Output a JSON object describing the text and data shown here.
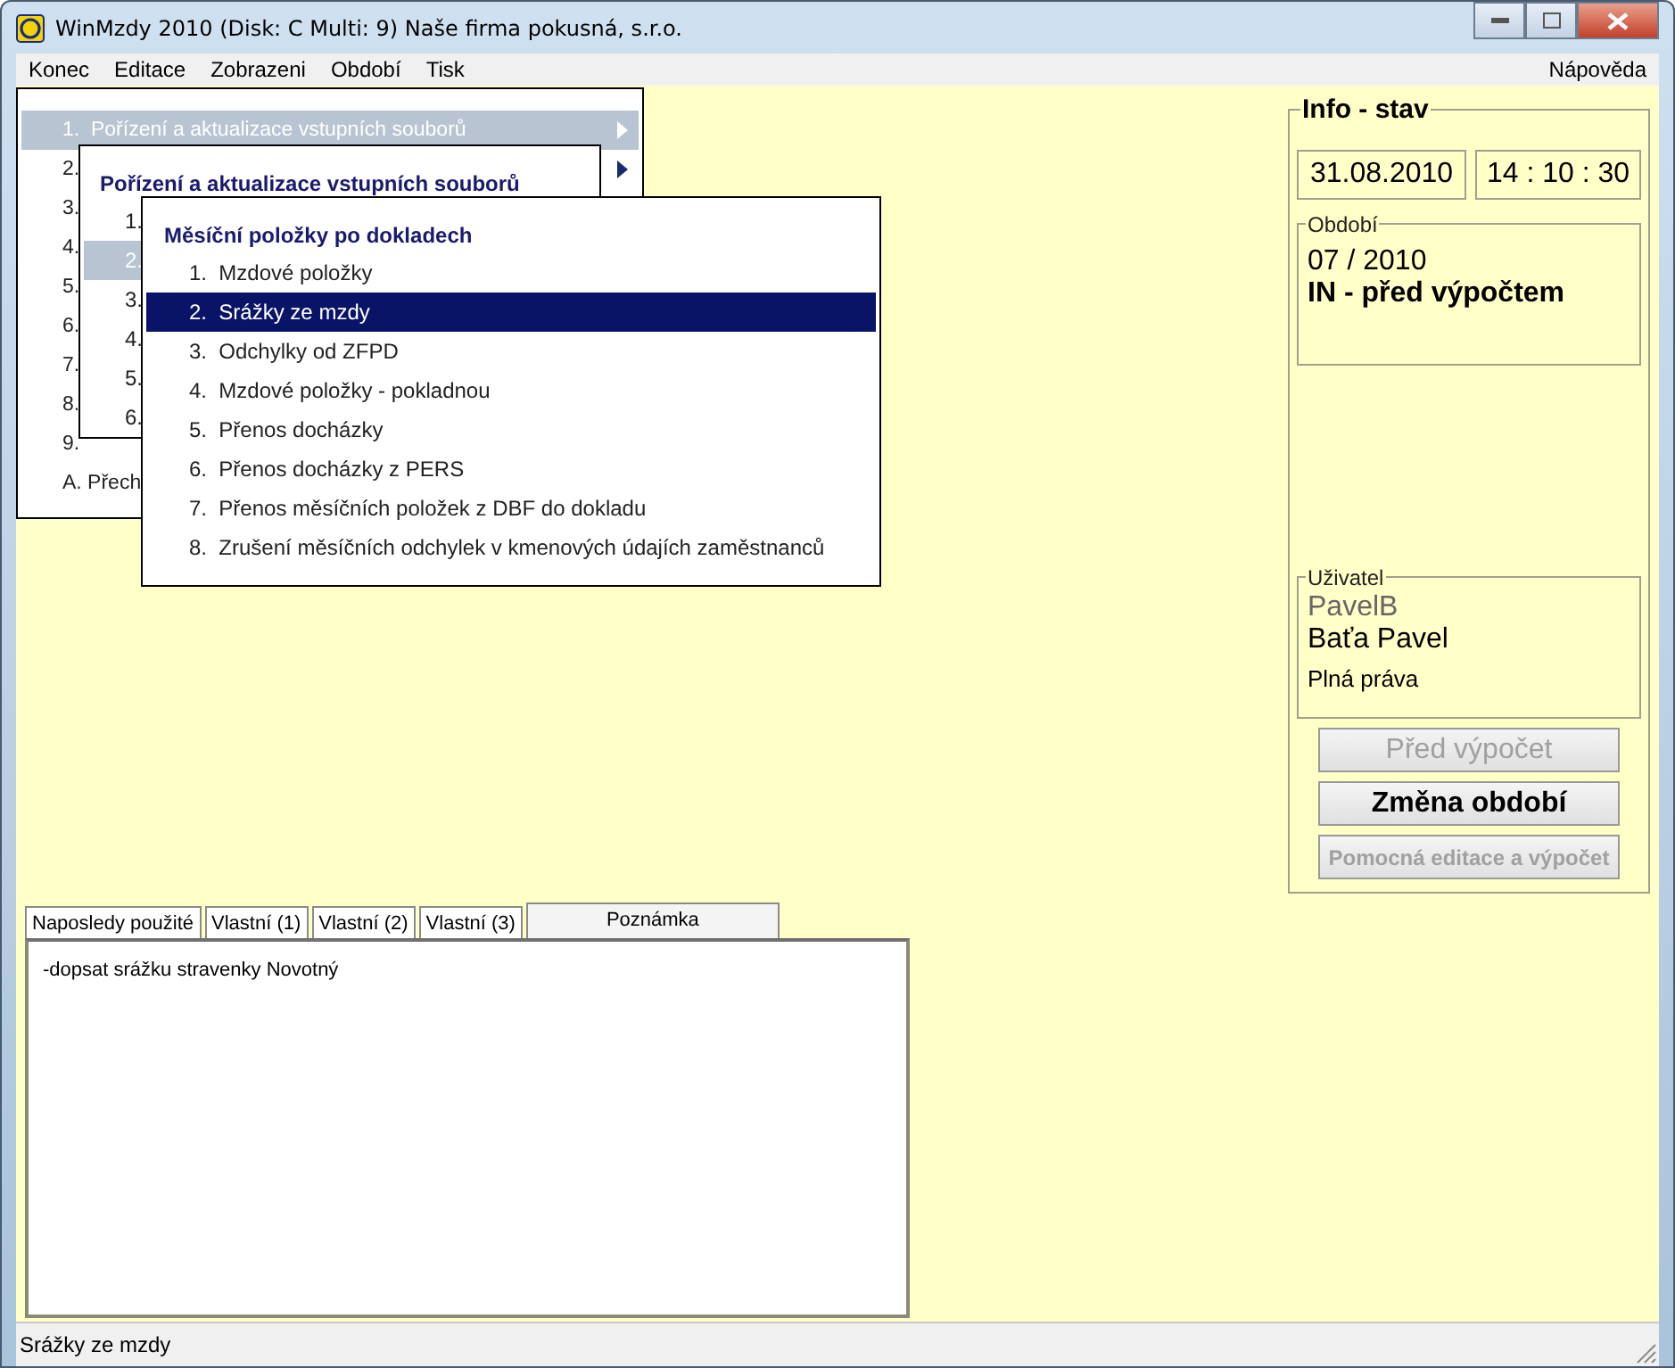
{
  "window": {
    "title": "WinMzdy 2010 (Disk: C Multi: 9) Naše firma pokusná, s.r.o."
  },
  "menu_bar": {
    "items": [
      "Konec",
      "Editace",
      "Zobrazeni",
      "Období",
      "Tisk"
    ],
    "help": "Nápověda"
  },
  "menus": [
    {
      "items": [
        {
          "label": "1.  Pořízení a aktualizace vstupních souborů",
          "selected": true,
          "submenu": true
        },
        {
          "label": "2.",
          "selected": false,
          "submenu": true
        },
        {
          "label": "3.",
          "selected": false
        },
        {
          "label": "4.",
          "selected": false
        },
        {
          "label": "5.",
          "selected": false
        },
        {
          "label": "6.",
          "selected": false
        },
        {
          "label": "7.",
          "selected": false
        },
        {
          "label": "8.",
          "selected": false
        },
        {
          "label": "9.",
          "selected": false
        },
        {
          "label": "A. Přech",
          "selected": false
        }
      ]
    },
    {
      "title": "Pořízení a aktualizace vstupních souborů",
      "items": [
        {
          "label": "1.",
          "selected": false
        },
        {
          "label": "2.",
          "selected": true
        },
        {
          "label": "3.",
          "selected": false
        },
        {
          "label": "4.",
          "selected": false
        },
        {
          "label": "5.",
          "selected": false
        },
        {
          "label": "6.",
          "selected": false
        }
      ]
    },
    {
      "title": "Měsíční položky po dokladech",
      "items": [
        {
          "label": "1.  Mzdové položky",
          "selected": false
        },
        {
          "label": "2.  Srážky ze mzdy",
          "selected": true
        },
        {
          "label": "3.  Odchylky od ZFPD",
          "selected": false
        },
        {
          "label": "4.  Mzdové položky - pokladnou",
          "selected": false
        },
        {
          "label": "5.  Přenos docházky",
          "selected": false
        },
        {
          "label": "6.  Přenos docházky z PERS",
          "selected": false
        },
        {
          "label": "7.  Přenos měsíčních položek z DBF do dokladu",
          "selected": false
        },
        {
          "label": "8.  Zrušení měsíčních odchylek v kmenových údajích zaměstnanců",
          "selected": false
        }
      ]
    }
  ],
  "info_panel": {
    "title": "Info - stav",
    "date": "31.08.2010",
    "time": "14 : 10 : 30",
    "period": {
      "legend": "Období",
      "value": "07 / 2010",
      "state": "IN - před výpočtem"
    },
    "user": {
      "legend": "Uživatel",
      "login": "PavelB",
      "name": "Baťa Pavel",
      "rights": "Plná práva"
    },
    "buttons": [
      {
        "label": "Před výpočet",
        "disabled": true,
        "kind": "large"
      },
      {
        "label": "Změna období",
        "disabled": false,
        "kind": "large"
      },
      {
        "label": "Pomocná editace a výpočet",
        "disabled": true,
        "kind": "small"
      }
    ]
  },
  "tabs": [
    {
      "label": "Naposledy použité",
      "selected": false
    },
    {
      "label": "Vlastní (1)",
      "selected": false
    },
    {
      "label": "Vlastní (2)",
      "selected": false
    },
    {
      "label": "Vlastní (3)",
      "selected": false
    },
    {
      "label": "Poznámka",
      "selected": true
    }
  ],
  "note": "-dopsat srážku stravenky Novotný",
  "status_bar": "Srážky ze mzdy"
}
